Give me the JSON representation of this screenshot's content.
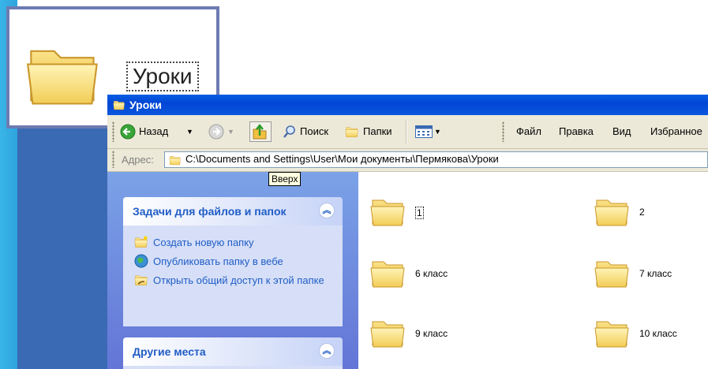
{
  "callout": {
    "label": "Уроки"
  },
  "window": {
    "title": "Уроки",
    "toolbar": {
      "back_label": "Назад",
      "search_label": "Поиск",
      "folders_label": "Папки",
      "menu": [
        "Файл",
        "Правка",
        "Вид",
        "Избранное"
      ]
    },
    "address": {
      "label": "Адрес:",
      "path": "C:\\Documents and Settings\\User\\Мои документы\\Пермякова\\Уроки"
    },
    "tooltip": "Вверх",
    "task_groups": [
      {
        "title": "Задачи для файлов и папок",
        "tasks": [
          {
            "icon": "new-folder-icon",
            "label": "Создать новую папку"
          },
          {
            "icon": "globe-publish-icon",
            "label": "Опубликовать папку в вебе"
          },
          {
            "icon": "share-folder-icon",
            "label": "Открыть общий доступ к этой папке"
          }
        ]
      },
      {
        "title": "Другие места",
        "tasks": []
      }
    ],
    "folders": [
      {
        "name": "1",
        "focused": true
      },
      {
        "name": "2"
      },
      {
        "name": "6 класс"
      },
      {
        "name": "7 класс"
      },
      {
        "name": "9 класс"
      },
      {
        "name": "10 класс"
      }
    ]
  },
  "colors": {
    "titlebar": "#0a56dd",
    "taskpane": "#6f8ee0",
    "slide_bg": "#3b6ab4",
    "accent_stripe": "#39b5e8"
  }
}
